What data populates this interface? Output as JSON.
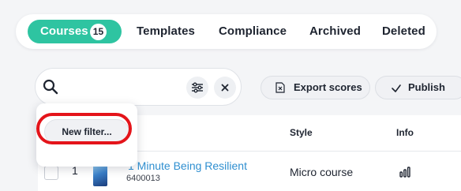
{
  "tabs": [
    {
      "label": "Courses",
      "count": "15",
      "active": true
    },
    {
      "label": "Templates"
    },
    {
      "label": "Compliance"
    },
    {
      "label": "Archived"
    },
    {
      "label": "Deleted"
    }
  ],
  "search": {
    "placeholder": "",
    "value": ""
  },
  "toolbar": {
    "export_label": "Export scores",
    "publish_label": "Publish"
  },
  "table": {
    "columns": {
      "style": "Style",
      "info": "Info"
    },
    "rows": [
      {
        "num": "1",
        "title": "1 Minute Being Resilient",
        "id": "6400013",
        "style": "Micro course"
      }
    ]
  },
  "filter_popup": {
    "new_filter_label": "New filter..."
  },
  "colors": {
    "accent": "#2ec4a1",
    "link": "#2f8fd0",
    "highlight": "#e4141a"
  }
}
